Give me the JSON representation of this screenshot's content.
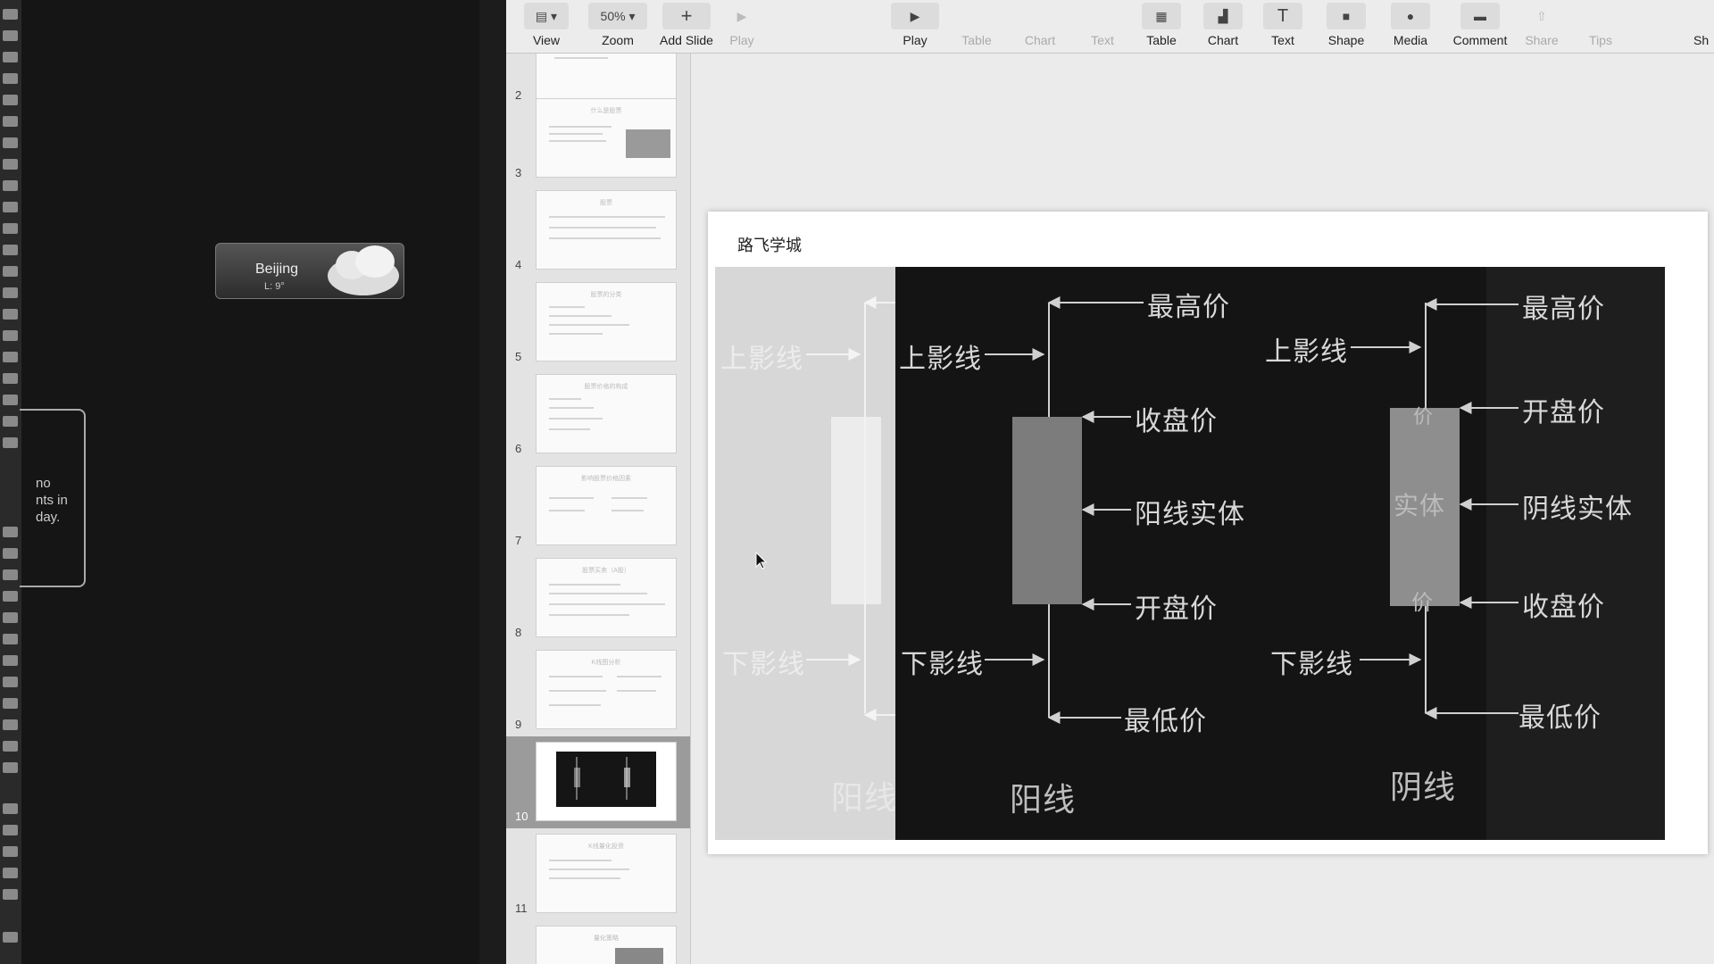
{
  "desktop": {
    "weather": {
      "city": "Beijing",
      "low": "L: 9°"
    },
    "calendar": {
      "text": "no\nnts in\nday."
    }
  },
  "toolbar": {
    "items": [
      {
        "label": "View",
        "icon": "sidebar-view-icon",
        "button_text": "▤ ▾"
      },
      {
        "label": "Zoom",
        "icon": "zoom-menu-icon",
        "button_text": "50% ▾"
      },
      {
        "label": "Add Slide",
        "icon": "plus-icon",
        "button_text": "+"
      },
      {
        "label": "Play",
        "icon": "play-icon",
        "button_text": "▶"
      },
      {
        "label": "Play",
        "icon": "play-icon",
        "button_text": "▶"
      },
      {
        "label": "Table",
        "icon": "table-icon",
        "button_text": "▦"
      },
      {
        "label": "Chart",
        "icon": "chart-icon",
        "button_text": "▟"
      },
      {
        "label": "Text",
        "icon": "text-icon",
        "button_text": "T"
      },
      {
        "label": "Shape",
        "icon": "shape-icon",
        "button_text": "■"
      },
      {
        "label": "Media",
        "icon": "media-icon",
        "button_text": "●"
      },
      {
        "label": "Comment",
        "icon": "comment-icon",
        "button_text": "▬"
      },
      {
        "label": "Share",
        "icon": "share-icon",
        "button_text": "⇧"
      },
      {
        "label": "Tips",
        "icon": "tips-icon",
        "button_text": ""
      },
      {
        "label": "Sh",
        "icon": "",
        "button_text": ""
      }
    ]
  },
  "navigator": {
    "slides": [
      {
        "number": "2",
        "title": ""
      },
      {
        "number": "3",
        "title": "什么是股票"
      },
      {
        "number": "4",
        "title": "股票"
      },
      {
        "number": "5",
        "title": "股票的分类"
      },
      {
        "number": "6",
        "title": "股票价格的构成"
      },
      {
        "number": "7",
        "title": "影响股票价格因素"
      },
      {
        "number": "8",
        "title": "股票买卖（A股）"
      },
      {
        "number": "9",
        "title": "K线图分析"
      },
      {
        "number": "10",
        "title": "",
        "selected": true
      },
      {
        "number": "11",
        "title": "K线量化投资"
      },
      {
        "number": "12",
        "title": "量化策略"
      }
    ]
  },
  "slide": {
    "header": "路飞学城",
    "ghost_labels": {
      "upper_shadow": "上影线",
      "lower_shadow": "下影线",
      "caption": "阳线"
    },
    "yang": {
      "caption": "阳线",
      "upper_shadow": "上影线",
      "lower_shadow": "下影线",
      "high": "最高价",
      "close": "收盘价",
      "body": "阳线实体",
      "open": "开盘价",
      "low": "最低价"
    },
    "yin": {
      "caption": "阴线",
      "upper_shadow": "上影线",
      "lower_shadow": "下影线",
      "high": "最高价",
      "open": "开盘价",
      "body": "阴线实体",
      "close": "收盘价",
      "low": "最低价",
      "inner_body": "实体",
      "inner_top": "价",
      "inner_bottom": "价"
    }
  }
}
